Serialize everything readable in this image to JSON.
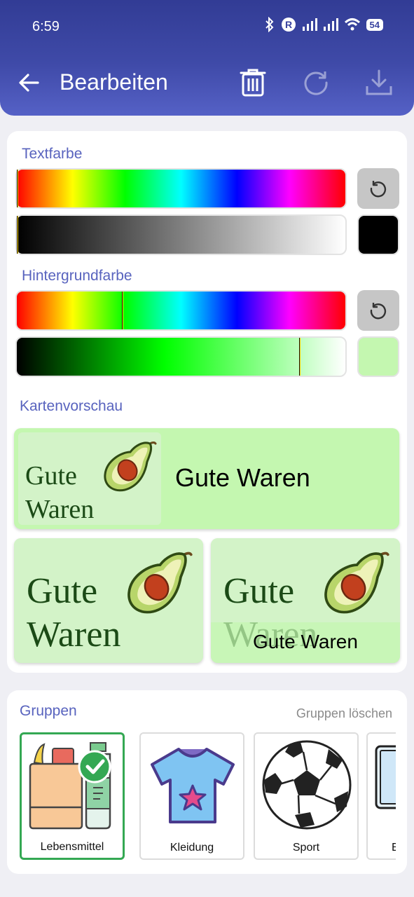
{
  "status": {
    "time": "6:59",
    "battery": "54"
  },
  "appbar": {
    "title": "Bearbeiten"
  },
  "text_color": {
    "label": "Textfarbe",
    "swatch_color": "#000000",
    "hue_fraction": 0.0,
    "shade_fraction": 0.0
  },
  "background_color": {
    "label": "Hintergrundfarbe",
    "swatch_color": "#c4f7b0",
    "hue_fraction": 0.32,
    "shade_fraction": 0.86
  },
  "preview": {
    "label": "Kartenvorschau",
    "card_text": "Gute Waren",
    "image_word1": "Gute",
    "image_word2": "Waren",
    "card_bg": "#c4f7b0"
  },
  "groups": {
    "label": "Gruppen",
    "clear_label": "Gruppen löschen",
    "items": [
      {
        "label": "Lebensmittel",
        "icon": "groceries-icon",
        "selected": true
      },
      {
        "label": "Kleidung",
        "icon": "tshirt-icon",
        "selected": false
      },
      {
        "label": "Sport",
        "icon": "soccer-ball-icon",
        "selected": false
      },
      {
        "label": "El",
        "icon": "electronics-icon",
        "selected": false
      }
    ]
  },
  "colors": {
    "accent": "#5863be",
    "appbar": "#3f4aa8",
    "selected_border": "#34a853"
  }
}
